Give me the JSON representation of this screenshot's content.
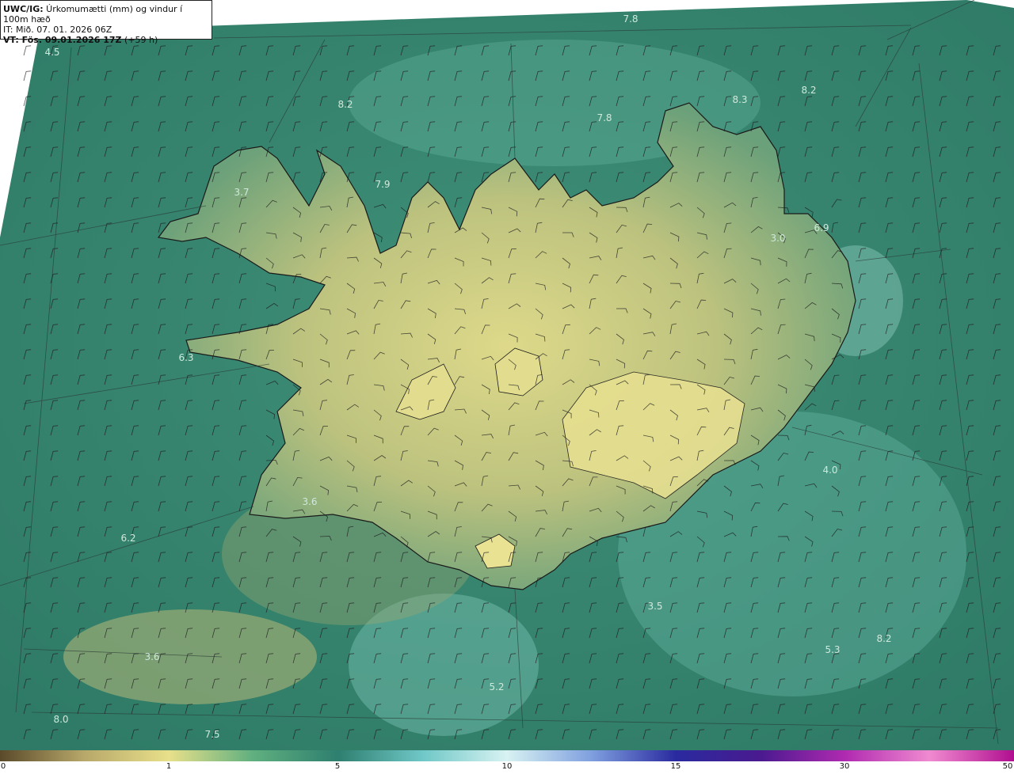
{
  "header": {
    "title_bold": "UWC/IG:",
    "title_rest": " Úrkomumætti (mm) og vindur í 100m hæð",
    "init_time": "IT: Mið. 07. 01. 2026 06Z",
    "valid_bold": "VT: Fös. 09.01.2026 17Z",
    "valid_rest": " (+59 h)"
  },
  "map_values": [
    "4.5",
    "7.8",
    "8.2",
    "7.8",
    "8.3",
    "8.2",
    "3.7",
    "7.9",
    "3.0",
    "6.9",
    "6.3",
    "3.6",
    "6.2",
    "3.5",
    "5.3",
    "8.2",
    "3.6",
    "5.2",
    "8.0",
    "7.5",
    "4.0"
  ],
  "colorbar": {
    "ticks": [
      "0",
      "1",
      "5",
      "10",
      "15",
      "30",
      "50"
    ],
    "colors": [
      "#5a4a2a",
      "#b8a86a",
      "#e8e08a",
      "#5faf7f",
      "#2e7f6f",
      "#6fc7c7",
      "#d8f2f2",
      "#7f9fdf",
      "#2a2a9f",
      "#4a1a8f",
      "#b02ab0",
      "#f08ad0",
      "#b00f8f"
    ]
  }
}
